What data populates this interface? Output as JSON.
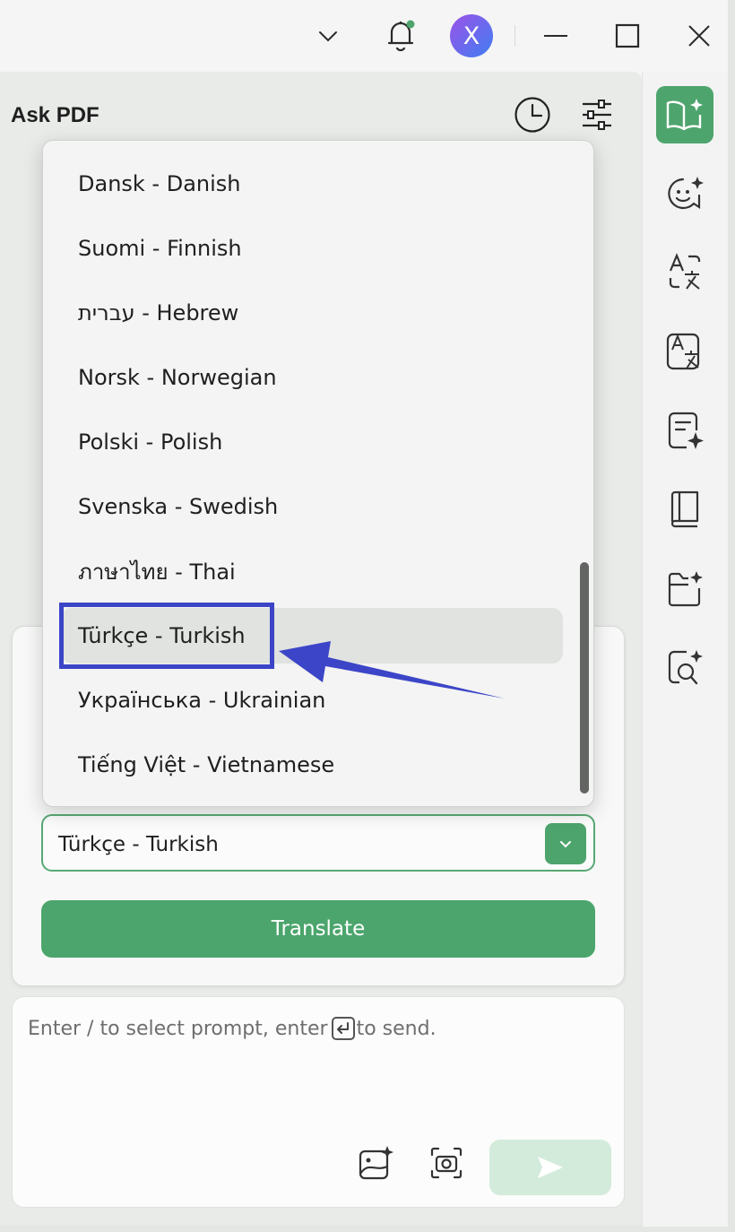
{
  "window": {
    "minimize_icon": "minimize-icon",
    "maximize_icon": "maximize-icon",
    "close_icon": "close-icon"
  },
  "user": {
    "avatar_letter": "X"
  },
  "header": {
    "title": "Ask PDF"
  },
  "language_dropdown": {
    "options": [
      {
        "label": "Dansk - Danish"
      },
      {
        "label": "Suomi - Finnish"
      },
      {
        "label": "עברית - Hebrew"
      },
      {
        "label": "Norsk - Norwegian"
      },
      {
        "label": "Polski - Polish"
      },
      {
        "label": "Svenska - Swedish"
      },
      {
        "label": "ภาษาไทย - Thai"
      },
      {
        "label": "Türkçe - Turkish"
      },
      {
        "label": "Українська - Ukrainian"
      },
      {
        "label": "Tiếng Việt - Vietnamese"
      }
    ],
    "selected_index": 7
  },
  "translate_panel": {
    "selected_language": "Türkçe - Turkish",
    "translate_label": "Translate"
  },
  "chat": {
    "placeholder_before": "Enter / to select prompt, enter",
    "placeholder_after": "to send."
  },
  "colors": {
    "accent": "#4ea46d",
    "annotation": "#3c45c7"
  }
}
